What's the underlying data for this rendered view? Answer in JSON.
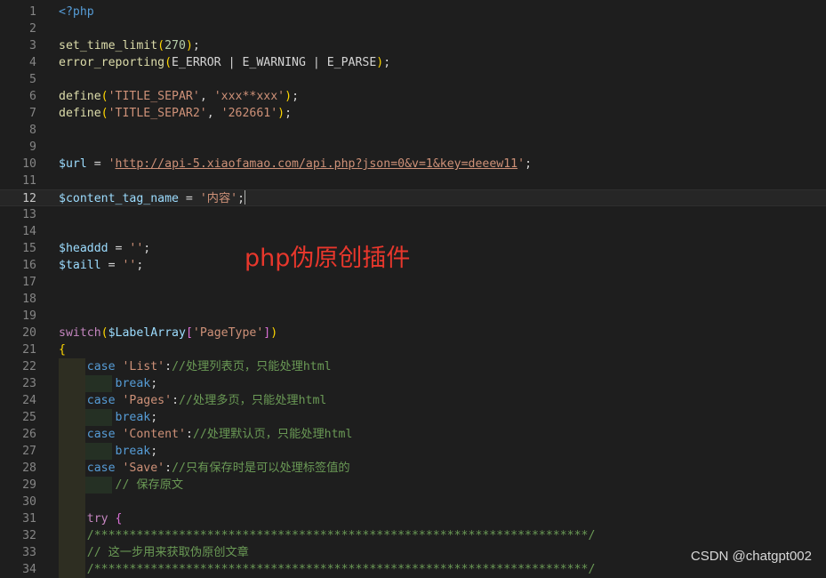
{
  "overlay_title": "php伪原创插件",
  "watermark": "CSDN @chatgpt002",
  "current_line": 12,
  "lines": [
    {
      "n": "1",
      "html": "<span class=\"t-tag\">&lt;?php</span>"
    },
    {
      "n": "2",
      "html": ""
    },
    {
      "n": "3",
      "html": "<span class=\"t-fn\">set_time_limit</span><span class=\"t-p1\">(</span><span class=\"t-num\">270</span><span class=\"t-p1\">)</span>;"
    },
    {
      "n": "4",
      "html": "<span class=\"t-fn\">error_reporting</span><span class=\"t-p1\">(</span>E_ERROR | E_WARNING | E_PARSE<span class=\"t-p1\">)</span>;"
    },
    {
      "n": "5",
      "html": ""
    },
    {
      "n": "6",
      "html": "<span class=\"t-fn\">define</span><span class=\"t-p1\">(</span><span class=\"t-str\">'TITLE_SEPAR'</span>, <span class=\"t-str\">'xxx**xxx'</span><span class=\"t-p1\">)</span>;"
    },
    {
      "n": "7",
      "html": "<span class=\"t-fn\">define</span><span class=\"t-p1\">(</span><span class=\"t-str\">'TITLE_SEPAR2'</span>, <span class=\"t-str\">'262661'</span><span class=\"t-p1\">)</span>;"
    },
    {
      "n": "8",
      "html": ""
    },
    {
      "n": "9",
      "html": ""
    },
    {
      "n": "10",
      "html": "<span class=\"t-var\">$url</span> = <span class=\"t-str\">'<span class=\"t-url\">http://api-5.xiaofamao.com/api.php?json=0&amp;v=1&amp;key=deeew11</span>'</span>;"
    },
    {
      "n": "11",
      "html": ""
    },
    {
      "n": "12",
      "html": "<span class=\"t-var\">$content_tag_name</span> = <span class=\"t-str\">'内容'</span>;<span class=\"cursor\"></span>"
    },
    {
      "n": "13",
      "html": ""
    },
    {
      "n": "14",
      "html": ""
    },
    {
      "n": "15",
      "html": "<span class=\"t-var\">$headdd</span> = <span class=\"t-str\">''</span>;"
    },
    {
      "n": "16",
      "html": "<span class=\"t-var\">$taill</span> = <span class=\"t-str\">''</span>;"
    },
    {
      "n": "17",
      "html": ""
    },
    {
      "n": "18",
      "html": ""
    },
    {
      "n": "19",
      "html": ""
    },
    {
      "n": "20",
      "html": "<span class=\"t-ctl\">switch</span><span class=\"t-p1\">(</span><span class=\"t-var\">$LabelArray</span><span class=\"t-p2\">[</span><span class=\"t-str\">'PageType'</span><span class=\"t-p2\">]</span><span class=\"t-p1\">)</span>"
    },
    {
      "n": "21",
      "html": "<span class=\"t-p1\">{</span>"
    },
    {
      "n": "22",
      "g": 1,
      "html": "    <span class=\"t-kw\">case</span> <span class=\"t-str\">'List'</span>:<span class=\"t-cmt\">//处理列表页，只能处理html</span>"
    },
    {
      "n": "23",
      "g": 2,
      "html": "        <span class=\"t-kw\">break</span>;"
    },
    {
      "n": "24",
      "g": 1,
      "html": "    <span class=\"t-kw\">case</span> <span class=\"t-str\">'Pages'</span>:<span class=\"t-cmt\">//处理多页，只能处理html</span>"
    },
    {
      "n": "25",
      "g": 2,
      "html": "        <span class=\"t-kw\">break</span>;"
    },
    {
      "n": "26",
      "g": 1,
      "html": "    <span class=\"t-kw\">case</span> <span class=\"t-str\">'Content'</span>:<span class=\"t-cmt\">//处理默认页，只能处理html</span>"
    },
    {
      "n": "27",
      "g": 2,
      "html": "        <span class=\"t-kw\">break</span>;"
    },
    {
      "n": "28",
      "g": 1,
      "html": "    <span class=\"t-kw\">case</span> <span class=\"t-str\">'Save'</span>:<span class=\"t-cmt\">//只有保存时是可以处理标签值的</span>"
    },
    {
      "n": "29",
      "g": 2,
      "html": "        <span class=\"t-cmt\">// 保存原文</span>"
    },
    {
      "n": "30",
      "g": 1,
      "html": ""
    },
    {
      "n": "31",
      "g": 1,
      "html": "    <span class=\"t-ctl\">try</span> <span class=\"t-p2\">{</span>"
    },
    {
      "n": "32",
      "g": 1,
      "html": "    <span class=\"t-cmt\">/**********************************************************************/</span>"
    },
    {
      "n": "33",
      "g": 1,
      "html": "    <span class=\"t-cmt\">// 这一步用来获取伪原创文章</span>"
    },
    {
      "n": "34",
      "g": 1,
      "html": "    <span class=\"t-cmt\">/**********************************************************************/</span>"
    }
  ]
}
